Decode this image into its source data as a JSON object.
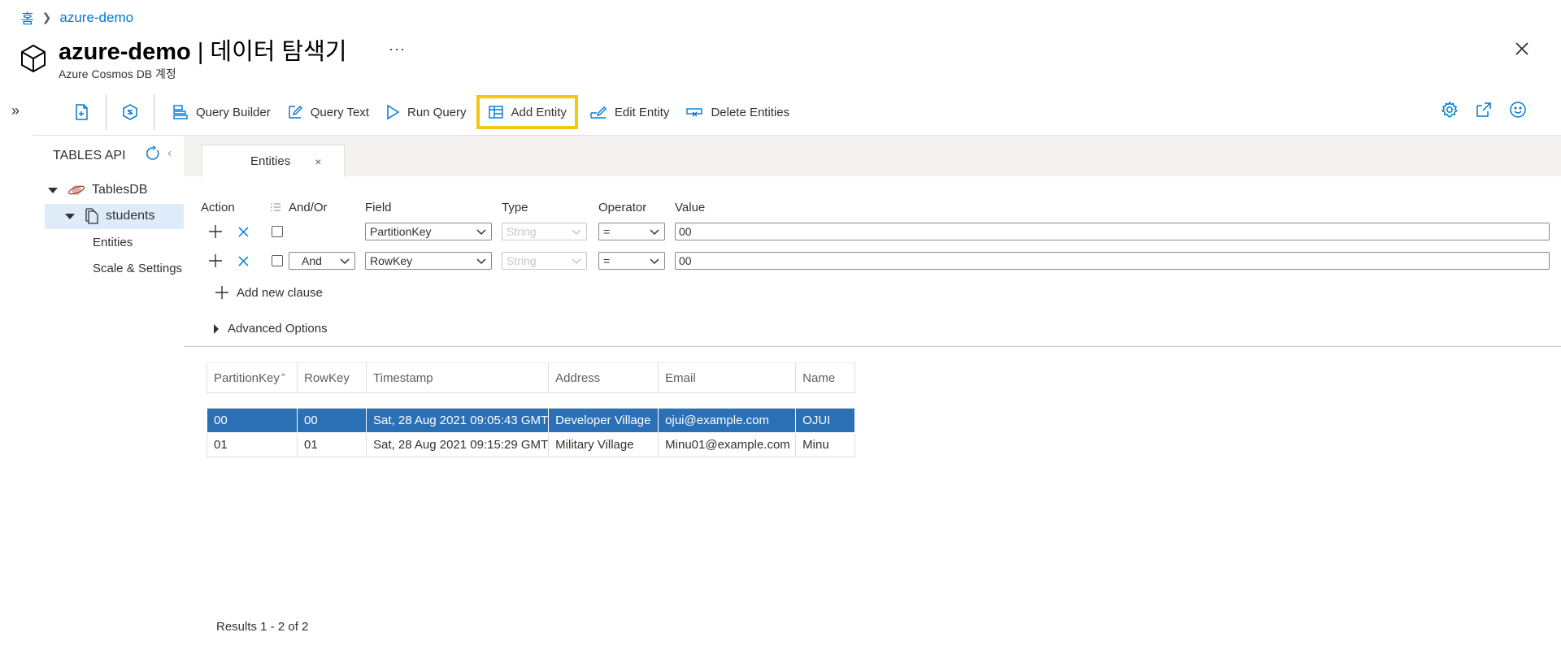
{
  "breadcrumb": {
    "home": "홈",
    "current": "azure-demo"
  },
  "header": {
    "resource_name": "azure-demo",
    "title_suffix": " | 데이터 탐색기",
    "subtitle": "Azure Cosmos DB 계정",
    "more": "···"
  },
  "toolbar": {
    "expand": "»",
    "query_builder": "Query Builder",
    "query_text": "Query Text",
    "run_query": "Run Query",
    "add_entity": "Add Entity",
    "edit_entity": "Edit Entity",
    "delete_entities": "Delete Entities"
  },
  "left_panel": {
    "title": "TABLES API",
    "collapse": "‹",
    "database": "TablesDB",
    "table": "students",
    "children": [
      "Entities",
      "Scale & Settings"
    ]
  },
  "tabs": {
    "entities": "Entities",
    "close": "×"
  },
  "query": {
    "headers": {
      "action": "Action",
      "and_or": "And/Or",
      "field": "Field",
      "type": "Type",
      "operator": "Operator",
      "value": "Value"
    },
    "clauses": [
      {
        "and_or": "",
        "field": "PartitionKey",
        "type": "String",
        "operator": "=",
        "value": "00"
      },
      {
        "and_or": "And",
        "field": "RowKey",
        "type": "String",
        "operator": "=",
        "value": "00"
      }
    ],
    "add_clause": "Add new clause",
    "advanced_options": "Advanced Options"
  },
  "results": {
    "columns": [
      "PartitionKey",
      "RowKey",
      "Timestamp",
      "Address",
      "Email",
      "Name"
    ],
    "rows": [
      [
        "00",
        "00",
        "Sat, 28 Aug 2021 09:05:43 GMT",
        "Developer Village",
        "ojui@example.com",
        "OJUI"
      ],
      [
        "01",
        "01",
        "Sat, 28 Aug 2021 09:15:29 GMT",
        "Military Village",
        "Minu01@example.com",
        "Minu"
      ]
    ],
    "footer": "Results 1 - 2 of 2"
  },
  "colors": {
    "accent": "#0078d4",
    "highlight": "#f2c811",
    "selected_row": "#2b6fb5"
  }
}
